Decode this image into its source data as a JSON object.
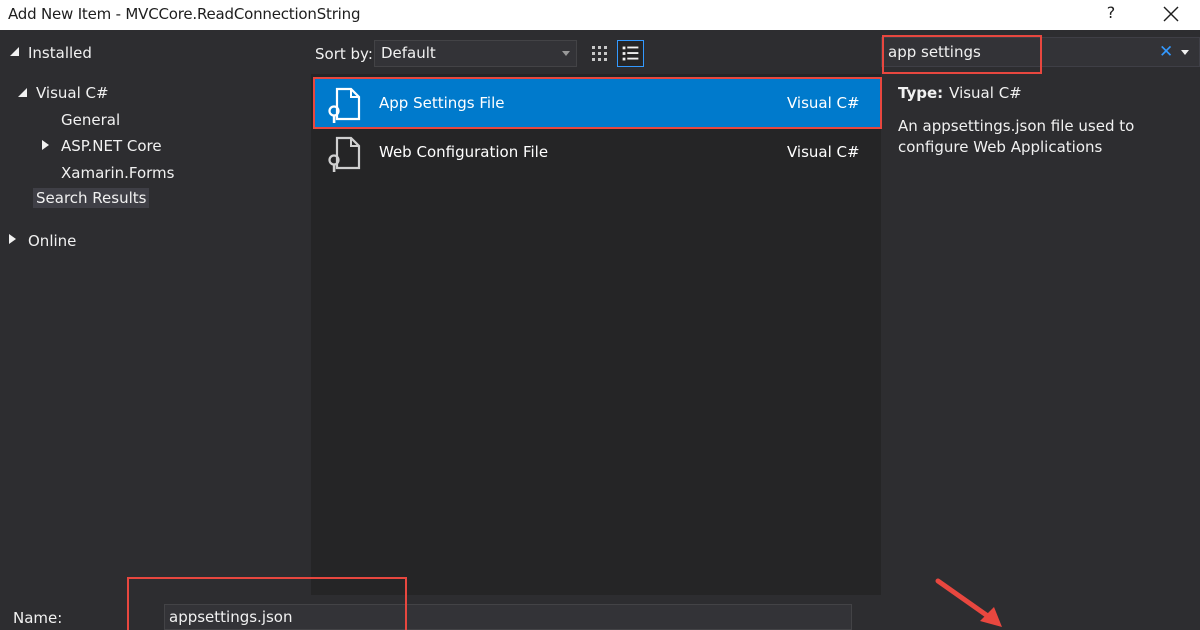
{
  "window": {
    "title": "Add New Item - MVCCore.ReadConnectionString",
    "help_label": "?"
  },
  "tree": {
    "installed": "Installed",
    "visual_csharp": "Visual C#",
    "general": "General",
    "aspnet_core": "ASP.NET Core",
    "xamarin_forms": "Xamarin.Forms",
    "search_results": "Search Results",
    "online": "Online"
  },
  "toolbar": {
    "sort_label": "Sort by:",
    "sort_value": "Default"
  },
  "search": {
    "value": "app settings",
    "clear_label": "✕"
  },
  "items": [
    {
      "name": "App Settings File",
      "lang": "Visual C#",
      "icon": "config-file-icon"
    },
    {
      "name": "Web Configuration File",
      "lang": "Visual C#",
      "icon": "config-file-icon"
    }
  ],
  "details": {
    "type_label": "Type:",
    "type_value": "Visual C#",
    "description": "An appsettings.json file used to configure Web Applications"
  },
  "bottom": {
    "name_label": "Name:",
    "name_value": "appsettings.json"
  },
  "colors": {
    "accent": "#007acc",
    "highlight": "#e8473f",
    "background": "#2d2d30",
    "list_background": "#252526"
  }
}
